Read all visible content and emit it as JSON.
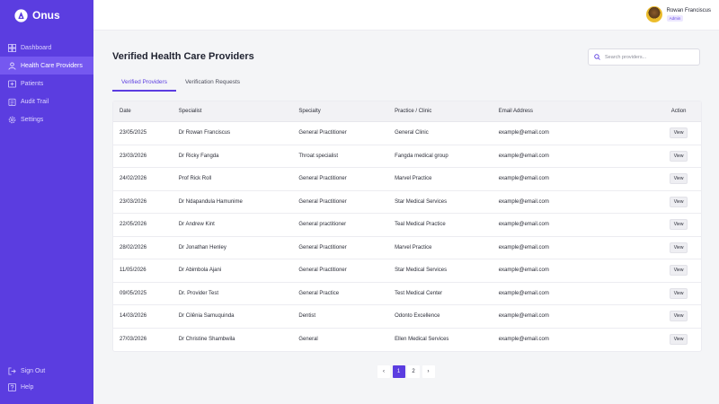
{
  "brand": {
    "name": "Onus"
  },
  "sidebar": {
    "items": [
      {
        "label": "Dashboard",
        "icon": "dashboard-icon"
      },
      {
        "label": "Health Care Providers",
        "icon": "users-icon",
        "active": true
      },
      {
        "label": "Patients",
        "icon": "patients-icon"
      },
      {
        "label": "Audit Trail",
        "icon": "clipboard-icon"
      },
      {
        "label": "Settings",
        "icon": "gear-icon"
      }
    ],
    "bottom": [
      {
        "label": "Sign Out",
        "icon": "sign-out-icon"
      },
      {
        "label": "Help",
        "icon": "help-icon"
      }
    ]
  },
  "user": {
    "name": "Rowan Franciscus",
    "role": "Admin"
  },
  "page": {
    "title": "Verified Health Care Providers",
    "search_placeholder": "Search providers..."
  },
  "tabs": [
    {
      "label": "Verified Providers",
      "active": true
    },
    {
      "label": "Verification Requests",
      "active": false
    }
  ],
  "table": {
    "headers": [
      "Date",
      "Specialist",
      "Specialty",
      "Practice / Clinic",
      "Email Address",
      "Action"
    ],
    "rows": [
      {
        "date": "23/05/2025",
        "specialist": "Dr Rowan Franciscus",
        "specialty": "General Practitioner",
        "practice": "General Clinic",
        "email": "example@email.com",
        "action": "View"
      },
      {
        "date": "23/03/2026",
        "specialist": "Dr Ricky Fangda",
        "specialty": "Throat specialist",
        "practice": "Fangda medical group",
        "email": "example@email.com",
        "action": "View"
      },
      {
        "date": "24/02/2026",
        "specialist": "Prof Rick Roll",
        "specialty": "General Practitioner",
        "practice": "Marvel Practice",
        "email": "example@email.com",
        "action": "View"
      },
      {
        "date": "23/03/2026",
        "specialist": "Dr Ndapandula Hamunime",
        "specialty": "General Practitioner",
        "practice": "Star Medical Services",
        "email": "example@email.com",
        "action": "View"
      },
      {
        "date": "22/05/2026",
        "specialist": "Dr Andrew Kint",
        "specialty": "General practitioner",
        "practice": "Teal Medical Practice",
        "email": "example@email.com",
        "action": "View"
      },
      {
        "date": "28/02/2026",
        "specialist": "Dr Jonathan Henley",
        "specialty": "General Practitioner",
        "practice": "Marvel Practice",
        "email": "example@email.com",
        "action": "View"
      },
      {
        "date": "11/05/2026",
        "specialist": "Dr Abimbola Ajani",
        "specialty": "General Practitioner",
        "practice": "Star Medical Services",
        "email": "example@email.com",
        "action": "View"
      },
      {
        "date": "09/05/2025",
        "specialist": "Dr. Provider Test",
        "specialty": "General Practice",
        "practice": "Test Medical Center",
        "email": "example@email.com",
        "action": "View"
      },
      {
        "date": "14/03/2026",
        "specialist": "Dr Cilênia Samuquinda",
        "specialty": "Dentist",
        "practice": "Odonto Excellence",
        "email": "example@email.com",
        "action": "View"
      },
      {
        "date": "27/03/2026",
        "specialist": "Dr Christine Shambwila",
        "specialty": "General",
        "practice": "Ellen Medical Services",
        "email": "example@email.com",
        "action": "View"
      }
    ]
  },
  "pagination": {
    "prev": "‹",
    "pages": [
      "1",
      "2"
    ],
    "current": "1",
    "next": "›"
  },
  "colors": {
    "accent": "#5b3de0",
    "sidebar_active": "#7558f0",
    "background": "#f4f5f7"
  }
}
